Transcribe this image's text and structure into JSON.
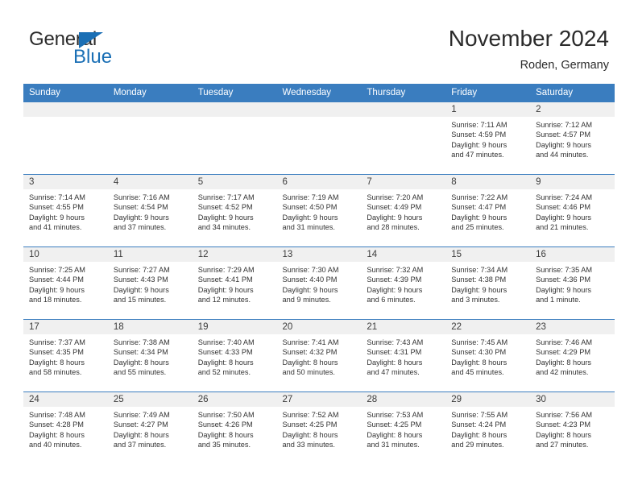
{
  "brand": {
    "name_part1": "General",
    "name_part2": "Blue",
    "accent_color": "#1a6fb5",
    "triangle_icon": "brand-triangle-icon"
  },
  "header": {
    "title": "November 2024",
    "subtitle": "Roden, Germany"
  },
  "theme": {
    "header_bg": "#3a7dbf",
    "daynum_bg": "#f0f0f0",
    "grid_line": "#3a7dbf",
    "text": "#333333"
  },
  "weekday_headers": [
    "Sunday",
    "Monday",
    "Tuesday",
    "Wednesday",
    "Thursday",
    "Friday",
    "Saturday"
  ],
  "weeks": [
    [
      {
        "day": "",
        "empty": true
      },
      {
        "day": "",
        "empty": true
      },
      {
        "day": "",
        "empty": true
      },
      {
        "day": "",
        "empty": true
      },
      {
        "day": "",
        "empty": true
      },
      {
        "day": "1",
        "sunrise": "Sunrise: 7:11 AM",
        "sunset": "Sunset: 4:59 PM",
        "daylight1": "Daylight: 9 hours",
        "daylight2": "and 47 minutes."
      },
      {
        "day": "2",
        "sunrise": "Sunrise: 7:12 AM",
        "sunset": "Sunset: 4:57 PM",
        "daylight1": "Daylight: 9 hours",
        "daylight2": "and 44 minutes."
      }
    ],
    [
      {
        "day": "3",
        "sunrise": "Sunrise: 7:14 AM",
        "sunset": "Sunset: 4:55 PM",
        "daylight1": "Daylight: 9 hours",
        "daylight2": "and 41 minutes."
      },
      {
        "day": "4",
        "sunrise": "Sunrise: 7:16 AM",
        "sunset": "Sunset: 4:54 PM",
        "daylight1": "Daylight: 9 hours",
        "daylight2": "and 37 minutes."
      },
      {
        "day": "5",
        "sunrise": "Sunrise: 7:17 AM",
        "sunset": "Sunset: 4:52 PM",
        "daylight1": "Daylight: 9 hours",
        "daylight2": "and 34 minutes."
      },
      {
        "day": "6",
        "sunrise": "Sunrise: 7:19 AM",
        "sunset": "Sunset: 4:50 PM",
        "daylight1": "Daylight: 9 hours",
        "daylight2": "and 31 minutes."
      },
      {
        "day": "7",
        "sunrise": "Sunrise: 7:20 AM",
        "sunset": "Sunset: 4:49 PM",
        "daylight1": "Daylight: 9 hours",
        "daylight2": "and 28 minutes."
      },
      {
        "day": "8",
        "sunrise": "Sunrise: 7:22 AM",
        "sunset": "Sunset: 4:47 PM",
        "daylight1": "Daylight: 9 hours",
        "daylight2": "and 25 minutes."
      },
      {
        "day": "9",
        "sunrise": "Sunrise: 7:24 AM",
        "sunset": "Sunset: 4:46 PM",
        "daylight1": "Daylight: 9 hours",
        "daylight2": "and 21 minutes."
      }
    ],
    [
      {
        "day": "10",
        "sunrise": "Sunrise: 7:25 AM",
        "sunset": "Sunset: 4:44 PM",
        "daylight1": "Daylight: 9 hours",
        "daylight2": "and 18 minutes."
      },
      {
        "day": "11",
        "sunrise": "Sunrise: 7:27 AM",
        "sunset": "Sunset: 4:43 PM",
        "daylight1": "Daylight: 9 hours",
        "daylight2": "and 15 minutes."
      },
      {
        "day": "12",
        "sunrise": "Sunrise: 7:29 AM",
        "sunset": "Sunset: 4:41 PM",
        "daylight1": "Daylight: 9 hours",
        "daylight2": "and 12 minutes."
      },
      {
        "day": "13",
        "sunrise": "Sunrise: 7:30 AM",
        "sunset": "Sunset: 4:40 PM",
        "daylight1": "Daylight: 9 hours",
        "daylight2": "and 9 minutes."
      },
      {
        "day": "14",
        "sunrise": "Sunrise: 7:32 AM",
        "sunset": "Sunset: 4:39 PM",
        "daylight1": "Daylight: 9 hours",
        "daylight2": "and 6 minutes."
      },
      {
        "day": "15",
        "sunrise": "Sunrise: 7:34 AM",
        "sunset": "Sunset: 4:38 PM",
        "daylight1": "Daylight: 9 hours",
        "daylight2": "and 3 minutes."
      },
      {
        "day": "16",
        "sunrise": "Sunrise: 7:35 AM",
        "sunset": "Sunset: 4:36 PM",
        "daylight1": "Daylight: 9 hours",
        "daylight2": "and 1 minute."
      }
    ],
    [
      {
        "day": "17",
        "sunrise": "Sunrise: 7:37 AM",
        "sunset": "Sunset: 4:35 PM",
        "daylight1": "Daylight: 8 hours",
        "daylight2": "and 58 minutes."
      },
      {
        "day": "18",
        "sunrise": "Sunrise: 7:38 AM",
        "sunset": "Sunset: 4:34 PM",
        "daylight1": "Daylight: 8 hours",
        "daylight2": "and 55 minutes."
      },
      {
        "day": "19",
        "sunrise": "Sunrise: 7:40 AM",
        "sunset": "Sunset: 4:33 PM",
        "daylight1": "Daylight: 8 hours",
        "daylight2": "and 52 minutes."
      },
      {
        "day": "20",
        "sunrise": "Sunrise: 7:41 AM",
        "sunset": "Sunset: 4:32 PM",
        "daylight1": "Daylight: 8 hours",
        "daylight2": "and 50 minutes."
      },
      {
        "day": "21",
        "sunrise": "Sunrise: 7:43 AM",
        "sunset": "Sunset: 4:31 PM",
        "daylight1": "Daylight: 8 hours",
        "daylight2": "and 47 minutes."
      },
      {
        "day": "22",
        "sunrise": "Sunrise: 7:45 AM",
        "sunset": "Sunset: 4:30 PM",
        "daylight1": "Daylight: 8 hours",
        "daylight2": "and 45 minutes."
      },
      {
        "day": "23",
        "sunrise": "Sunrise: 7:46 AM",
        "sunset": "Sunset: 4:29 PM",
        "daylight1": "Daylight: 8 hours",
        "daylight2": "and 42 minutes."
      }
    ],
    [
      {
        "day": "24",
        "sunrise": "Sunrise: 7:48 AM",
        "sunset": "Sunset: 4:28 PM",
        "daylight1": "Daylight: 8 hours",
        "daylight2": "and 40 minutes."
      },
      {
        "day": "25",
        "sunrise": "Sunrise: 7:49 AM",
        "sunset": "Sunset: 4:27 PM",
        "daylight1": "Daylight: 8 hours",
        "daylight2": "and 37 minutes."
      },
      {
        "day": "26",
        "sunrise": "Sunrise: 7:50 AM",
        "sunset": "Sunset: 4:26 PM",
        "daylight1": "Daylight: 8 hours",
        "daylight2": "and 35 minutes."
      },
      {
        "day": "27",
        "sunrise": "Sunrise: 7:52 AM",
        "sunset": "Sunset: 4:25 PM",
        "daylight1": "Daylight: 8 hours",
        "daylight2": "and 33 minutes."
      },
      {
        "day": "28",
        "sunrise": "Sunrise: 7:53 AM",
        "sunset": "Sunset: 4:25 PM",
        "daylight1": "Daylight: 8 hours",
        "daylight2": "and 31 minutes."
      },
      {
        "day": "29",
        "sunrise": "Sunrise: 7:55 AM",
        "sunset": "Sunset: 4:24 PM",
        "daylight1": "Daylight: 8 hours",
        "daylight2": "and 29 minutes."
      },
      {
        "day": "30",
        "sunrise": "Sunrise: 7:56 AM",
        "sunset": "Sunset: 4:23 PM",
        "daylight1": "Daylight: 8 hours",
        "daylight2": "and 27 minutes."
      }
    ]
  ]
}
